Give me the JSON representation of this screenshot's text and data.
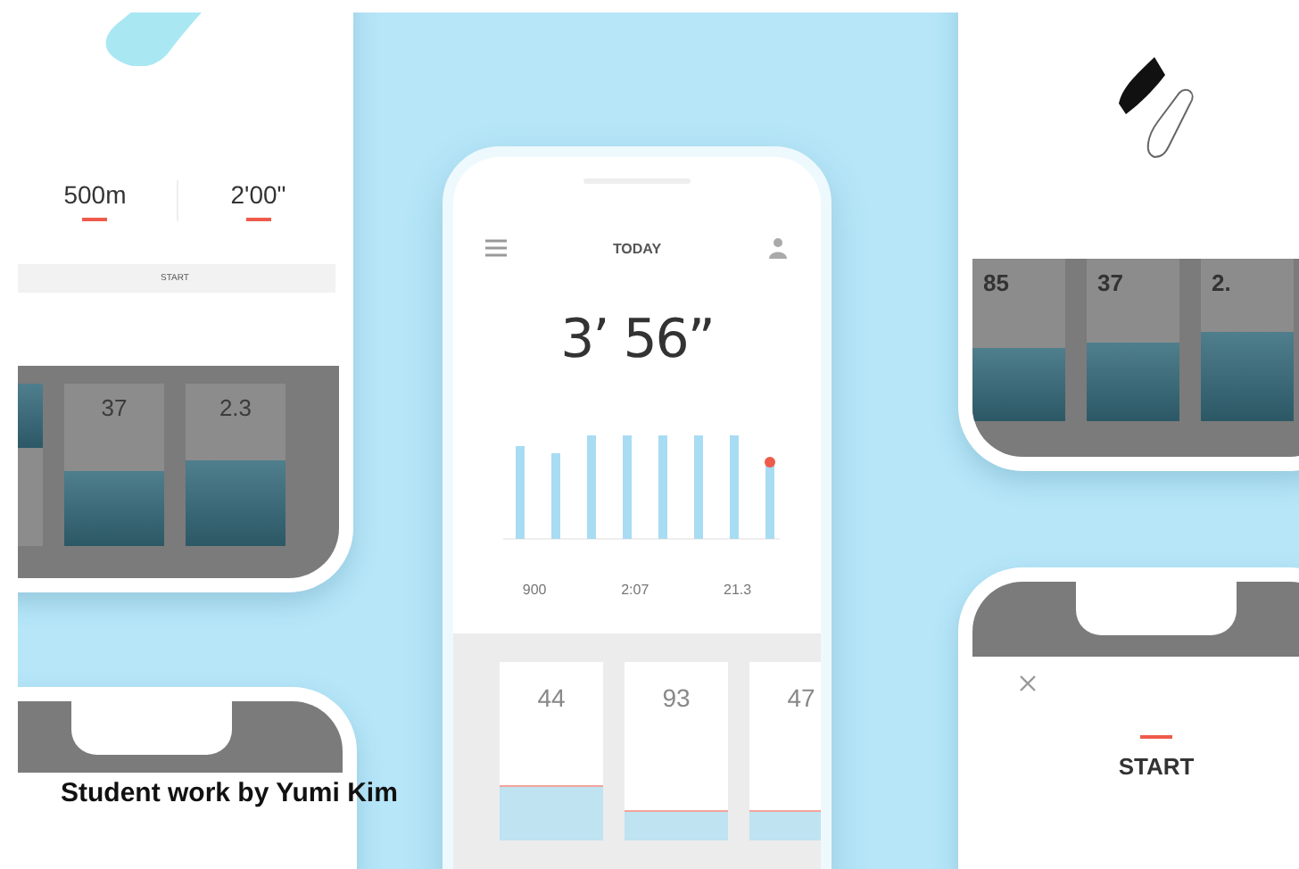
{
  "left_phone": {
    "stats": [
      {
        "value": "500m"
      },
      {
        "value": "2'00\""
      }
    ],
    "start_button": "START",
    "tiles": [
      {
        "level": 0.4
      },
      {
        "value": "37",
        "level": 0.46
      },
      {
        "value": "2.3",
        "level": 0.53
      }
    ]
  },
  "center_phone": {
    "title": "TODAY",
    "pace": "3’ 56”",
    "stats": [
      "900",
      "2:07",
      "21.3"
    ],
    "cards": [
      {
        "value": "44",
        "level": 0.3
      },
      {
        "value": "93",
        "level": 0.16
      },
      {
        "value": "47",
        "level": 0.16
      }
    ]
  },
  "right_phone": {
    "tiles": [
      {
        "value": "85",
        "level": 0.45
      },
      {
        "value": "37",
        "level": 0.48
      },
      {
        "value": "2.",
        "level": 0.55
      }
    ]
  },
  "start_phone": {
    "title": "START"
  },
  "caption": "Student work by Yumi Kim"
}
